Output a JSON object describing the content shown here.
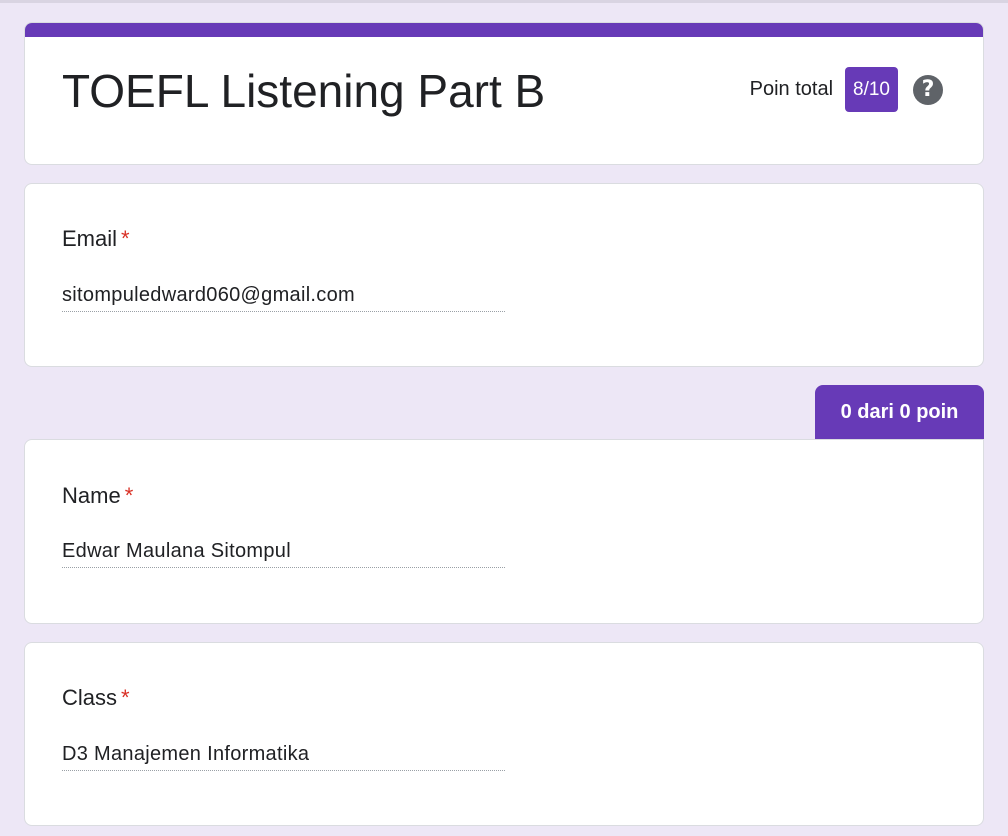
{
  "form": {
    "title": "TOEFL Listening Part B",
    "score_label": "Poin total",
    "score_value": "8/10",
    "help_icon": "help-circle-icon"
  },
  "questions": [
    {
      "label": "Email",
      "required_mark": "*",
      "answer": "sitompuledward060@gmail.com"
    },
    {
      "points": "0 dari 0 poin",
      "label": "Name",
      "required_mark": "*",
      "answer": "Edwar Maulana Sitompul"
    },
    {
      "label": "Class",
      "required_mark": "*",
      "answer": "D3 Manajemen Informatika"
    }
  ],
  "colors": {
    "accent": "#673ab7",
    "background": "#ede7f6",
    "required": "#d93025"
  }
}
